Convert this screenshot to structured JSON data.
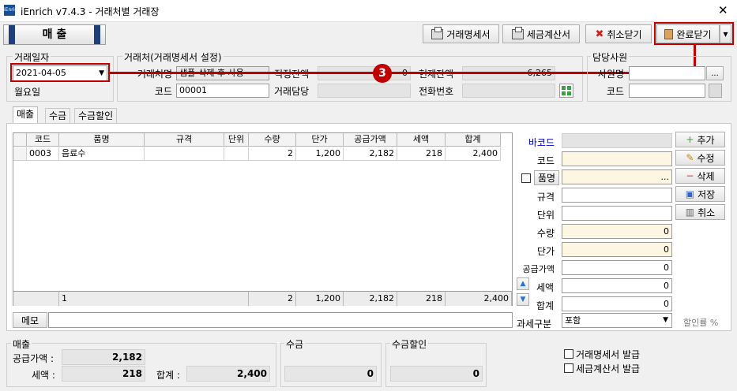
{
  "window": {
    "title": "iEnrich v7.4.3 - 거래처별 거래장",
    "icon_text": "iEnrich",
    "close": "✕"
  },
  "mode": {
    "label": "매 출"
  },
  "toolbar": {
    "statement_label": "거래명세서",
    "tax_invoice_label": "세금계산서",
    "cancel_close_label": "취소닫기",
    "complete_close_label": "완료닫기",
    "dropdown": "▾"
  },
  "trade_date": {
    "group": "거래일자",
    "value": "2021-04-05",
    "weekday": "월요일"
  },
  "client": {
    "group": "거래처(거래명세서 설정)",
    "name_label": "거래처명",
    "name_value": "샘플-삭제 후 사용",
    "code_label": "코드",
    "code_value": "00001",
    "proper_balance_label": "적정잔액",
    "proper_balance": "0",
    "current_balance_label": "현재잔액",
    "current_balance": "6,265",
    "manager_label": "거래담당",
    "phone_label": "전화번호"
  },
  "staff": {
    "group": "담당사원",
    "name_label": "사원명",
    "code_label": "코드",
    "ellipsis": "..."
  },
  "annotation": {
    "step": "3"
  },
  "tabs": [
    "매출",
    "수금",
    "수금할인"
  ],
  "grid": {
    "headers": [
      "코드",
      "품명",
      "규격",
      "단위",
      "수량",
      "단가",
      "공급가액",
      "세액",
      "합계"
    ],
    "rows": [
      [
        "0003",
        "음료수",
        "",
        "",
        "2",
        "1,200",
        "2,182",
        "218",
        "2,400"
      ]
    ],
    "footer": [
      "",
      "1",
      "",
      "",
      "2",
      "1,200",
      "2,182",
      "218",
      "2,400"
    ]
  },
  "form": {
    "barcode_label": "바코드",
    "code_label": "코드",
    "item_label": "품명",
    "spec_label": "규격",
    "unit_label": "단위",
    "qty_label": "수량",
    "qty": "0",
    "price_label": "단가",
    "price": "0",
    "supply_label": "공급가액",
    "supply": "0",
    "tax_label": "세액",
    "tax": "0",
    "total_label": "합계",
    "total": "0",
    "taxtype_label": "과세구분",
    "taxtype": "포함",
    "discount_label": "할인률 %",
    "ellipsis": "..."
  },
  "side_buttons": {
    "add": "추가",
    "edit": "수정",
    "delete": "삭제",
    "save": "저장",
    "cancel": "취소"
  },
  "memo": {
    "label": "메모",
    "value": ""
  },
  "summary": {
    "sales_group": "매출",
    "supply_label": "공급가액 :",
    "supply": "2,182",
    "tax_label": "세액 :",
    "tax": "218",
    "total_label": "합계 :",
    "total": "2,400",
    "collection_group": "수금",
    "collection": "0",
    "discount_group": "수금할인",
    "discount": "0"
  },
  "issue": {
    "statement": "거래명세서 발급",
    "tax_invoice": "세금계산서 발급"
  },
  "colors": {
    "highlight": "#c00000",
    "link": "#0000cc",
    "accent": "#1f3f7a",
    "input_yellow": "#fdf6e3"
  }
}
